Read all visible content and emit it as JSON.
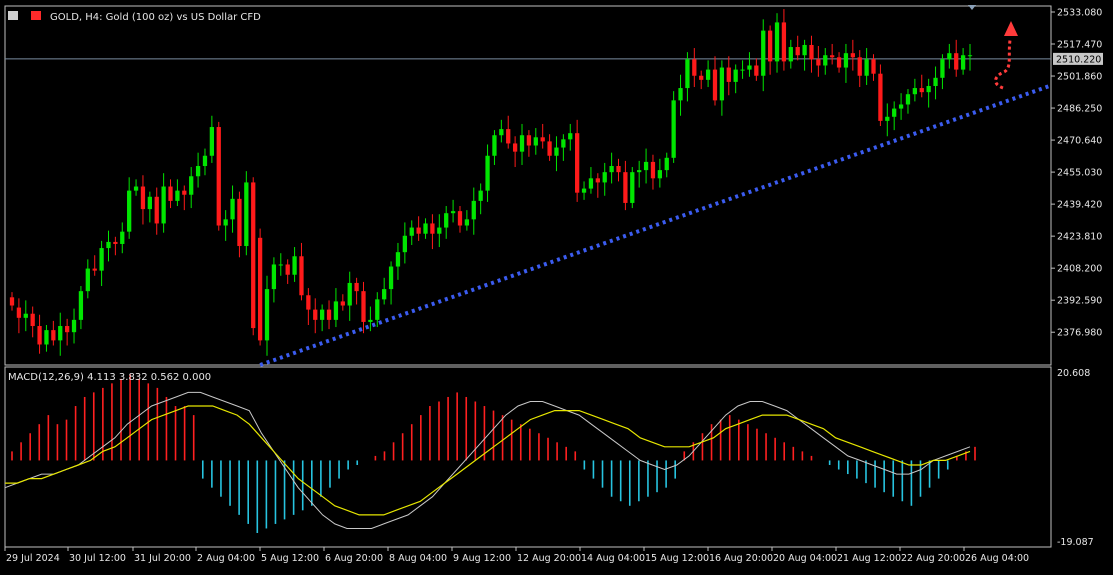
{
  "header": {
    "symbol_title": "GOLD, H4:  Gold (100 oz) vs US Dollar CFD"
  },
  "macd": {
    "label": "MACD(12,26,9) 4.113 3.832 0.562 0.000",
    "y_ticks": [
      "20.608",
      "-19.087"
    ]
  },
  "colors": {
    "background": "#000000",
    "bull": "#00e600",
    "bear": "#ff1a1a",
    "trendline": "#3b5cf0",
    "arrow": "#ff3b3b",
    "macd_hist_pos": "#ff2020",
    "macd_hist_neg": "#27c4e0",
    "macd_line": "#c8c8c8",
    "signal_line": "#e6e600",
    "grid_frame": "#c0c0c0"
  },
  "chart_data": {
    "type": "candlestick",
    "ylim": [
      2361.0,
      2536.0
    ],
    "y_ticks": [
      "2533.080",
      "2517.470",
      "2501.860",
      "2486.250",
      "2470.640",
      "2455.030",
      "2439.420",
      "2423.810",
      "2408.200",
      "2392.590",
      "2376.980"
    ],
    "current_price": "2510.220",
    "x_labels": [
      "29 Jul 2024",
      "30 Jul 12:00",
      "31 Jul 20:00",
      "2 Aug 04:00",
      "5 Aug 12:00",
      "6 Aug 20:00",
      "8 Aug 04:00",
      "9 Aug 12:00",
      "12 Aug 20:00",
      "14 Aug 04:00",
      "15 Aug 12:00",
      "16 Aug 20:00",
      "20 Aug 04:00",
      "21 Aug 12:00",
      "22 Aug 20:00",
      "26 Aug 04:00"
    ],
    "candles": [
      {
        "o": 2394,
        "c": 2390
      },
      {
        "o": 2389,
        "c": 2384
      },
      {
        "o": 2384,
        "c": 2386
      },
      {
        "o": 2386,
        "c": 2380
      },
      {
        "o": 2380,
        "c": 2371
      },
      {
        "o": 2371,
        "c": 2378
      },
      {
        "o": 2378,
        "c": 2373
      },
      {
        "o": 2373,
        "c": 2380
      },
      {
        "o": 2380,
        "c": 2377
      },
      {
        "o": 2377,
        "c": 2383
      },
      {
        "o": 2383,
        "c": 2397
      },
      {
        "o": 2397,
        "c": 2408
      },
      {
        "o": 2408,
        "c": 2407
      },
      {
        "o": 2407,
        "c": 2418
      },
      {
        "o": 2418,
        "c": 2421
      },
      {
        "o": 2421,
        "c": 2420
      },
      {
        "o": 2420,
        "c": 2426
      },
      {
        "o": 2426,
        "c": 2446
      },
      {
        "o": 2446,
        "c": 2448
      },
      {
        "o": 2448,
        "c": 2437
      },
      {
        "o": 2437,
        "c": 2443
      },
      {
        "o": 2443,
        "c": 2430
      },
      {
        "o": 2430,
        "c": 2448
      },
      {
        "o": 2448,
        "c": 2441
      },
      {
        "o": 2441,
        "c": 2446
      },
      {
        "o": 2446,
        "c": 2444
      },
      {
        "o": 2444,
        "c": 2453
      },
      {
        "o": 2453,
        "c": 2458
      },
      {
        "o": 2458,
        "c": 2463
      },
      {
        "o": 2463,
        "c": 2477
      },
      {
        "o": 2477,
        "c": 2429
      },
      {
        "o": 2429,
        "c": 2432
      },
      {
        "o": 2432,
        "c": 2442
      },
      {
        "o": 2442,
        "c": 2419
      },
      {
        "o": 2419,
        "c": 2450
      },
      {
        "o": 2450,
        "c": 2379
      },
      {
        "o": 2423,
        "c": 2373
      },
      {
        "o": 2373,
        "c": 2398
      },
      {
        "o": 2398,
        "c": 2410
      },
      {
        "o": 2410,
        "c": 2410
      },
      {
        "o": 2410,
        "c": 2405
      },
      {
        "o": 2405,
        "c": 2414
      },
      {
        "o": 2414,
        "c": 2395
      },
      {
        "o": 2395,
        "c": 2388
      },
      {
        "o": 2388,
        "c": 2383
      },
      {
        "o": 2383,
        "c": 2388
      },
      {
        "o": 2388,
        "c": 2383
      },
      {
        "o": 2383,
        "c": 2392
      },
      {
        "o": 2392,
        "c": 2390
      },
      {
        "o": 2390,
        "c": 2401
      },
      {
        "o": 2401,
        "c": 2397
      },
      {
        "o": 2397,
        "c": 2382
      },
      {
        "o": 2382,
        "c": 2383
      },
      {
        "o": 2383,
        "c": 2393
      },
      {
        "o": 2393,
        "c": 2398
      },
      {
        "o": 2398,
        "c": 2409
      },
      {
        "o": 2409,
        "c": 2416
      },
      {
        "o": 2416,
        "c": 2424
      },
      {
        "o": 2424,
        "c": 2428
      },
      {
        "o": 2428,
        "c": 2425
      },
      {
        "o": 2425,
        "c": 2430
      },
      {
        "o": 2430,
        "c": 2425
      },
      {
        "o": 2425,
        "c": 2428
      },
      {
        "o": 2428,
        "c": 2435
      },
      {
        "o": 2435,
        "c": 2436
      },
      {
        "o": 2436,
        "c": 2429
      },
      {
        "o": 2429,
        "c": 2432
      },
      {
        "o": 2432,
        "c": 2441
      },
      {
        "o": 2441,
        "c": 2446
      },
      {
        "o": 2446,
        "c": 2463
      },
      {
        "o": 2463,
        "c": 2473
      },
      {
        "o": 2473,
        "c": 2476
      },
      {
        "o": 2476,
        "c": 2469
      },
      {
        "o": 2469,
        "c": 2465
      },
      {
        "o": 2465,
        "c": 2473
      },
      {
        "o": 2473,
        "c": 2468
      },
      {
        "o": 2468,
        "c": 2472
      },
      {
        "o": 2472,
        "c": 2470
      },
      {
        "o": 2470,
        "c": 2463
      },
      {
        "o": 2463,
        "c": 2467
      },
      {
        "o": 2467,
        "c": 2471
      },
      {
        "o": 2471,
        "c": 2474
      },
      {
        "o": 2474,
        "c": 2445
      },
      {
        "o": 2445,
        "c": 2447
      },
      {
        "o": 2447,
        "c": 2452
      },
      {
        "o": 2452,
        "c": 2450
      },
      {
        "o": 2450,
        "c": 2455
      },
      {
        "o": 2455,
        "c": 2458
      },
      {
        "o": 2458,
        "c": 2455
      },
      {
        "o": 2455,
        "c": 2440
      },
      {
        "o": 2440,
        "c": 2455
      },
      {
        "o": 2455,
        "c": 2456
      },
      {
        "o": 2456,
        "c": 2460
      },
      {
        "o": 2460,
        "c": 2452
      },
      {
        "o": 2452,
        "c": 2456
      },
      {
        "o": 2456,
        "c": 2462
      },
      {
        "o": 2462,
        "c": 2490
      },
      {
        "o": 2490,
        "c": 2496
      },
      {
        "o": 2496,
        "c": 2510
      },
      {
        "o": 2510,
        "c": 2502
      },
      {
        "o": 2502,
        "c": 2500
      },
      {
        "o": 2500,
        "c": 2505
      },
      {
        "o": 2505,
        "c": 2490
      },
      {
        "o": 2490,
        "c": 2506
      },
      {
        "o": 2506,
        "c": 2499
      },
      {
        "o": 2499,
        "c": 2505
      },
      {
        "o": 2505,
        "c": 2505
      },
      {
        "o": 2505,
        "c": 2507
      },
      {
        "o": 2507,
        "c": 2502
      },
      {
        "o": 2502,
        "c": 2524
      },
      {
        "o": 2524,
        "c": 2509
      },
      {
        "o": 2509,
        "c": 2528
      },
      {
        "o": 2528,
        "c": 2509
      },
      {
        "o": 2509,
        "c": 2516
      },
      {
        "o": 2516,
        "c": 2512
      },
      {
        "o": 2512,
        "c": 2517
      },
      {
        "o": 2517,
        "c": 2510
      },
      {
        "o": 2510,
        "c": 2507
      },
      {
        "o": 2507,
        "c": 2512
      },
      {
        "o": 2512,
        "c": 2511
      },
      {
        "o": 2511,
        "c": 2506
      },
      {
        "o": 2506,
        "c": 2513
      },
      {
        "o": 2513,
        "c": 2511
      },
      {
        "o": 2511,
        "c": 2502
      },
      {
        "o": 2502,
        "c": 2510
      },
      {
        "o": 2510,
        "c": 2503
      },
      {
        "o": 2503,
        "c": 2480
      },
      {
        "o": 2480,
        "c": 2482
      },
      {
        "o": 2482,
        "c": 2486
      },
      {
        "o": 2486,
        "c": 2488
      },
      {
        "o": 2488,
        "c": 2493
      },
      {
        "o": 2493,
        "c": 2496
      },
      {
        "o": 2496,
        "c": 2494
      },
      {
        "o": 2494,
        "c": 2497
      },
      {
        "o": 2497,
        "c": 2501
      },
      {
        "o": 2501,
        "c": 2510
      },
      {
        "o": 2510,
        "c": 2513
      },
      {
        "o": 2513,
        "c": 2505
      },
      {
        "o": 2505,
        "c": 2512
      },
      {
        "o": 2512,
        "c": 2512
      }
    ],
    "trendline": {
      "from": [
        36,
        2361
      ],
      "to": [
        148,
        2494
      ]
    },
    "macd": {
      "ylim": [
        -19.087,
        20.608
      ],
      "hist": [
        2,
        4,
        6,
        8,
        10,
        8,
        9,
        12,
        14,
        15,
        16,
        17,
        18,
        19,
        18,
        17,
        16,
        14,
        12,
        12,
        10,
        -4,
        -6,
        -8,
        -10,
        -12,
        -14,
        -16,
        -15,
        -14,
        -13,
        -12,
        -11,
        -10,
        -8,
        -6,
        -4,
        -2,
        -1,
        0,
        1,
        2,
        4,
        6,
        8,
        10,
        12,
        13,
        14,
        15,
        14,
        13,
        12,
        11,
        10,
        9,
        8,
        7,
        6,
        5,
        4,
        3,
        2,
        -2,
        -4,
        -6,
        -8,
        -9,
        -10,
        -9,
        -8,
        -7,
        -6,
        -4,
        2,
        4,
        6,
        8,
        9,
        10,
        9,
        8,
        7,
        6,
        5,
        4,
        3,
        2,
        1,
        0,
        -1,
        -2,
        -3,
        -4,
        -5,
        -6,
        -7,
        -8,
        -9,
        -10,
        -8,
        -6,
        -4,
        -2,
        1,
        2,
        3
      ],
      "macd_line": [
        -6,
        -5,
        -4,
        -3,
        -3,
        -2,
        -1,
        1,
        3,
        5,
        8,
        10,
        12,
        13,
        14,
        15,
        15,
        14,
        13,
        12,
        11,
        6,
        2,
        -2,
        -6,
        -9,
        -12,
        -14,
        -15,
        -15,
        -15,
        -14,
        -13,
        -12,
        -10,
        -8,
        -5,
        -2,
        1,
        4,
        7,
        10,
        12,
        13,
        13,
        12,
        11,
        10,
        8,
        6,
        4,
        2,
        0,
        -1,
        -2,
        -1,
        1,
        4,
        7,
        10,
        12,
        13,
        13,
        12,
        11,
        9,
        7,
        5,
        3,
        1,
        0,
        -1,
        -2,
        -3,
        -3,
        -2,
        0,
        1,
        2,
        3
      ],
      "signal_line": [
        -5,
        -5,
        -4,
        -4,
        -3,
        -2,
        -1,
        0,
        2,
        3,
        5,
        7,
        9,
        10,
        11,
        12,
        12,
        12,
        11,
        10,
        8,
        5,
        2,
        -1,
        -4,
        -6,
        -8,
        -10,
        -11,
        -12,
        -12,
        -12,
        -11,
        -10,
        -9,
        -7,
        -5,
        -3,
        -1,
        1,
        3,
        5,
        7,
        9,
        10,
        11,
        11,
        11,
        10,
        9,
        8,
        7,
        5,
        4,
        3,
        3,
        3,
        4,
        5,
        7,
        8,
        9,
        10,
        10,
        10,
        9,
        8,
        7,
        5,
        4,
        3,
        2,
        1,
        0,
        -1,
        -1,
        0,
        0,
        1,
        2
      ]
    }
  }
}
